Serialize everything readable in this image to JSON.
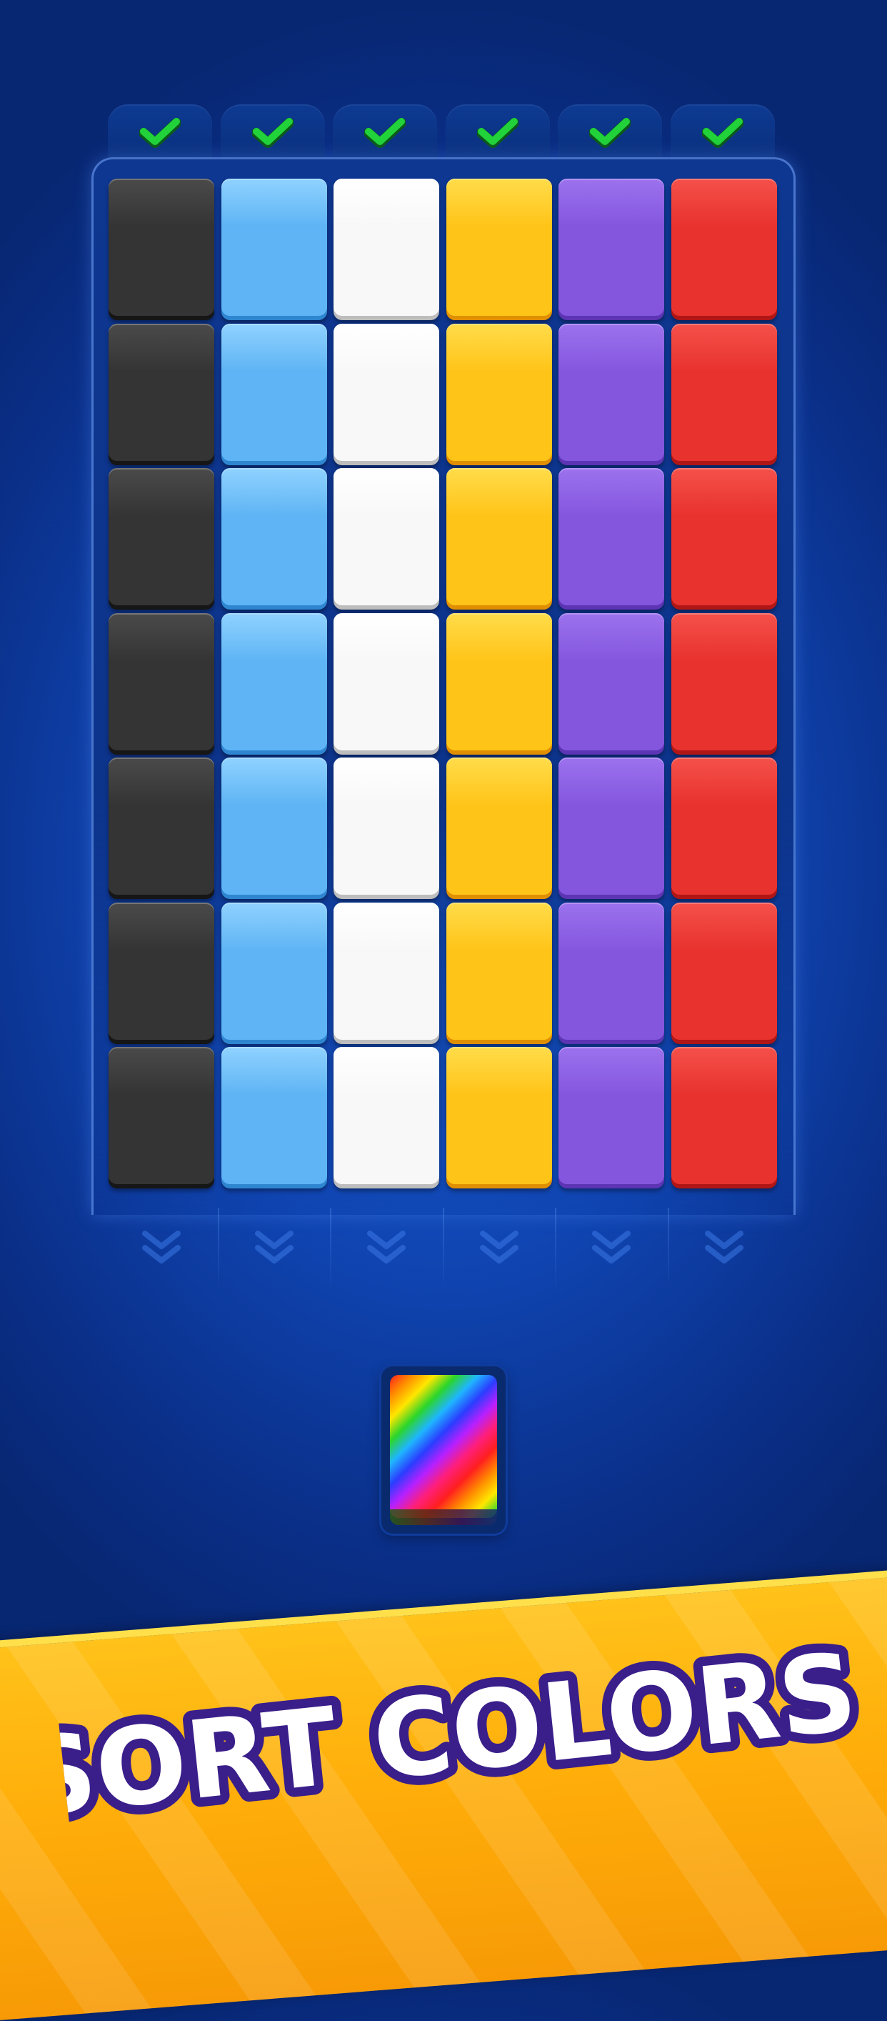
{
  "game": {
    "columns": [
      {
        "color_name": "black",
        "face": "#343434",
        "edge": "#161616",
        "highlight": "#4a4a4a",
        "complete": true
      },
      {
        "color_name": "light-blue",
        "face": "#5eb4f4",
        "edge": "#2f86d0",
        "highlight": "#8fd2ff",
        "complete": true
      },
      {
        "color_name": "white",
        "face": "#f8f8f8",
        "edge": "#bdbdbd",
        "highlight": "#ffffff",
        "complete": true
      },
      {
        "color_name": "yellow",
        "face": "#ffc418",
        "edge": "#e08f00",
        "highlight": "#ffdc4a",
        "complete": true
      },
      {
        "color_name": "purple",
        "face": "#8456de",
        "edge": "#5c34b4",
        "highlight": "#9c72ee",
        "complete": true
      },
      {
        "color_name": "red",
        "face": "#e8322e",
        "edge": "#b01616",
        "highlight": "#f5504a",
        "complete": true
      }
    ],
    "tiles_per_column": 7,
    "check_color": "#22d23a",
    "wild_card": {
      "name": "rainbow-card"
    }
  },
  "banner": {
    "text": "SORT COLORS!",
    "fill": "#ffffff",
    "outline": "#3a1e8a"
  }
}
